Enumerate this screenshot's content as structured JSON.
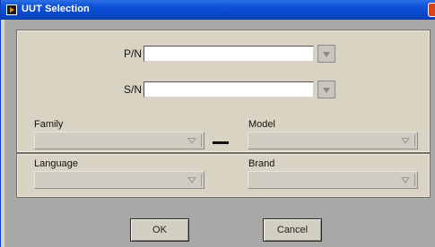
{
  "window": {
    "title": "UUT Selection"
  },
  "fields": {
    "pn": {
      "label": "P/N",
      "value": ""
    },
    "sn": {
      "label": "S/N",
      "value": ""
    },
    "family": {
      "label": "Family",
      "selected": ""
    },
    "model": {
      "label": "Model",
      "selected": ""
    },
    "language": {
      "label": "Language",
      "selected": ""
    },
    "brand": {
      "label": "Brand",
      "selected": ""
    }
  },
  "buttons": {
    "ok": "OK",
    "cancel": "Cancel"
  },
  "colors": {
    "titlebar": "#0a48c9",
    "panel": "#d8d3c3",
    "background": "#a9a8a8"
  }
}
